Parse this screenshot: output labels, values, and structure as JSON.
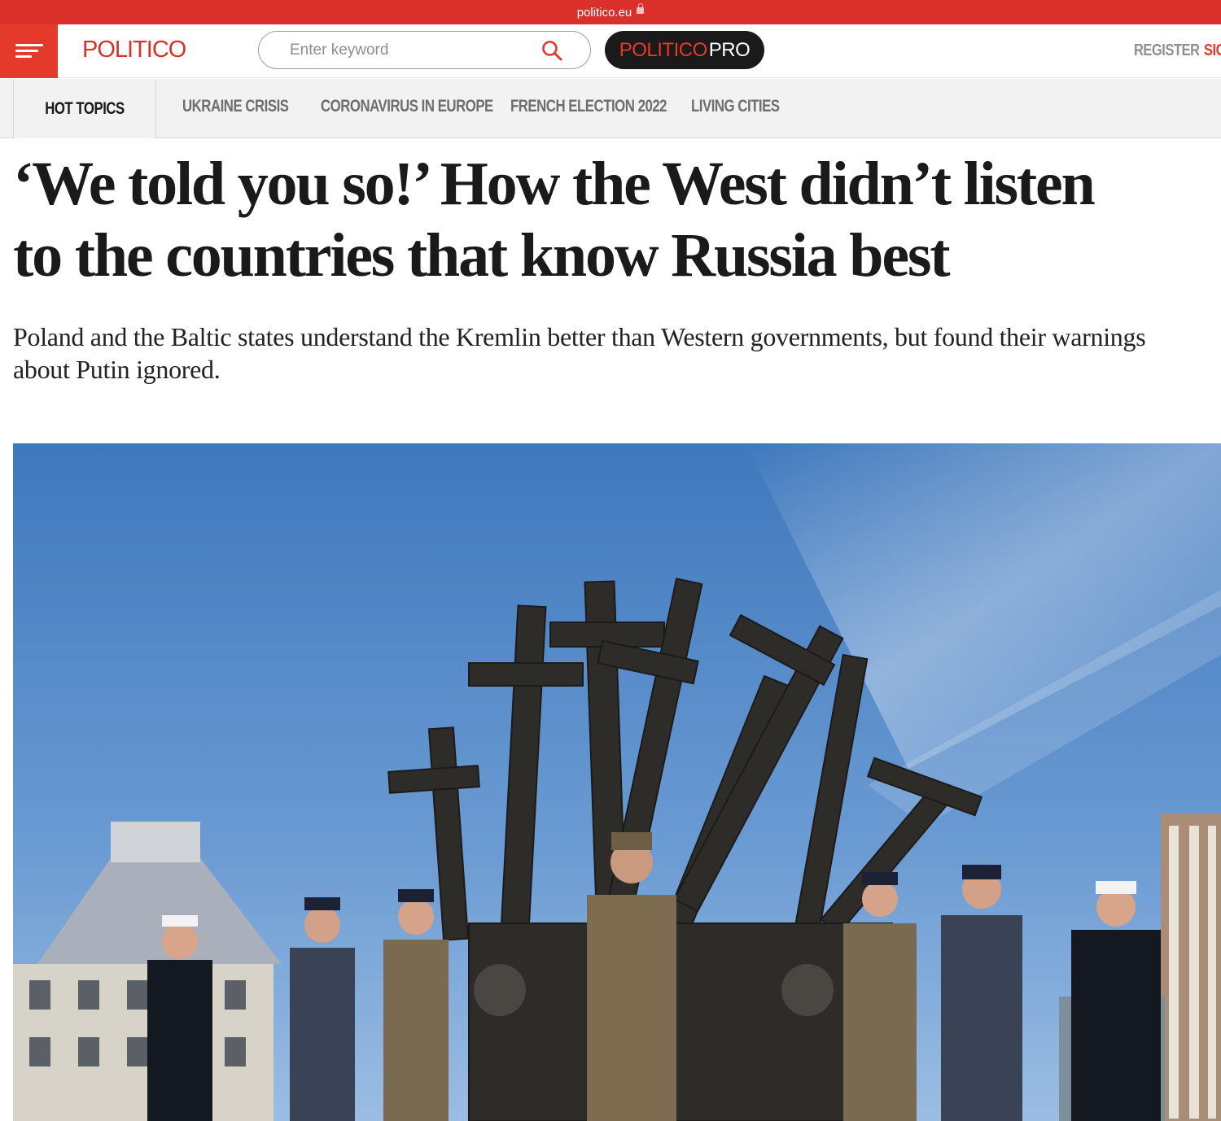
{
  "browser": {
    "url": "politico.eu"
  },
  "header": {
    "logo": "POLITICO",
    "search_placeholder": "Enter keyword",
    "pro_politico": "POLITICO",
    "pro_pro": "PRO",
    "register": "REGISTER",
    "signin": "SIG"
  },
  "topics": {
    "hot_label": "HOT TOPICS",
    "items": [
      {
        "label": "UKRAINE CRISIS"
      },
      {
        "label": "CORONAVIRUS IN EUROPE"
      },
      {
        "label": "FRENCH ELECTION 2022"
      },
      {
        "label": "LIVING CITIES"
      }
    ]
  },
  "article": {
    "headline_line1": "‘We told you so!’ How the West didn’t listen",
    "headline_line2": "to the countries that know Russia best",
    "dek": "Poland and the Baltic states understand the Kremlin better than Western governments, but found their warnings about Putin ignored."
  },
  "colors": {
    "brand_red": "#e5392c",
    "url_bar_red": "#d9302a",
    "text_dark": "#1a1a1a",
    "sky_blue": "#4f86c6"
  },
  "icons": {
    "menu": "hamburger-icon",
    "search": "magnifier-icon",
    "lock": "lock-icon"
  }
}
